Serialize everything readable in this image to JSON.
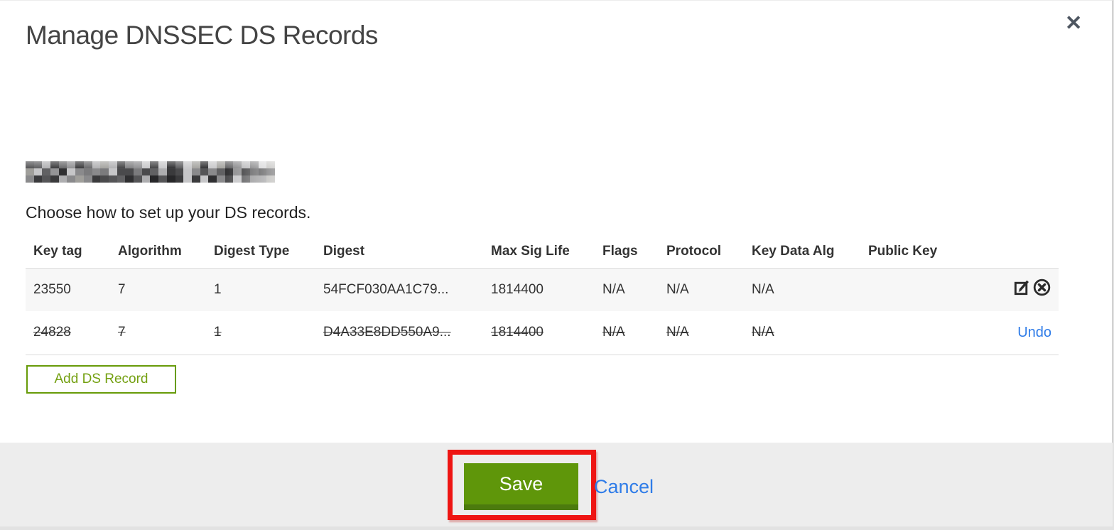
{
  "modal": {
    "title": "Manage DNSSEC DS Records",
    "close_glyph": "✕",
    "intro": "Choose how to set up your DS records."
  },
  "table": {
    "headers": [
      "Key tag",
      "Algorithm",
      "Digest Type",
      "Digest",
      "Max Sig Life",
      "Flags",
      "Protocol",
      "Key Data Alg",
      "Public Key"
    ],
    "rows": [
      {
        "key_tag": "23550",
        "algorithm": "7",
        "digest_type": "1",
        "digest": "54FCF030AA1C79...",
        "max_sig_life": "1814400",
        "flags": "N/A",
        "protocol": "N/A",
        "key_data_alg": "N/A",
        "public_key": "",
        "state": "active"
      },
      {
        "key_tag": "24828",
        "algorithm": "7",
        "digest_type": "1",
        "digest": "D4A33E8DD550A9...",
        "max_sig_life": "1814400",
        "flags": "N/A",
        "protocol": "N/A",
        "key_data_alg": "N/A",
        "public_key": "",
        "state": "deleted",
        "undo_label": "Undo"
      }
    ]
  },
  "buttons": {
    "add_ds_record": "Add DS Record",
    "save": "Save",
    "cancel": "Cancel"
  },
  "colors": {
    "accent_green": "#5f960a",
    "accent_green_dark": "#4c7a0e",
    "outline_green": "#679b08",
    "link_blue": "#2f7ce8",
    "annotation_red": "#ee1513",
    "footer_bg": "#ededed",
    "row_alt_bg": "#f7f7f7",
    "text": "#333333"
  }
}
